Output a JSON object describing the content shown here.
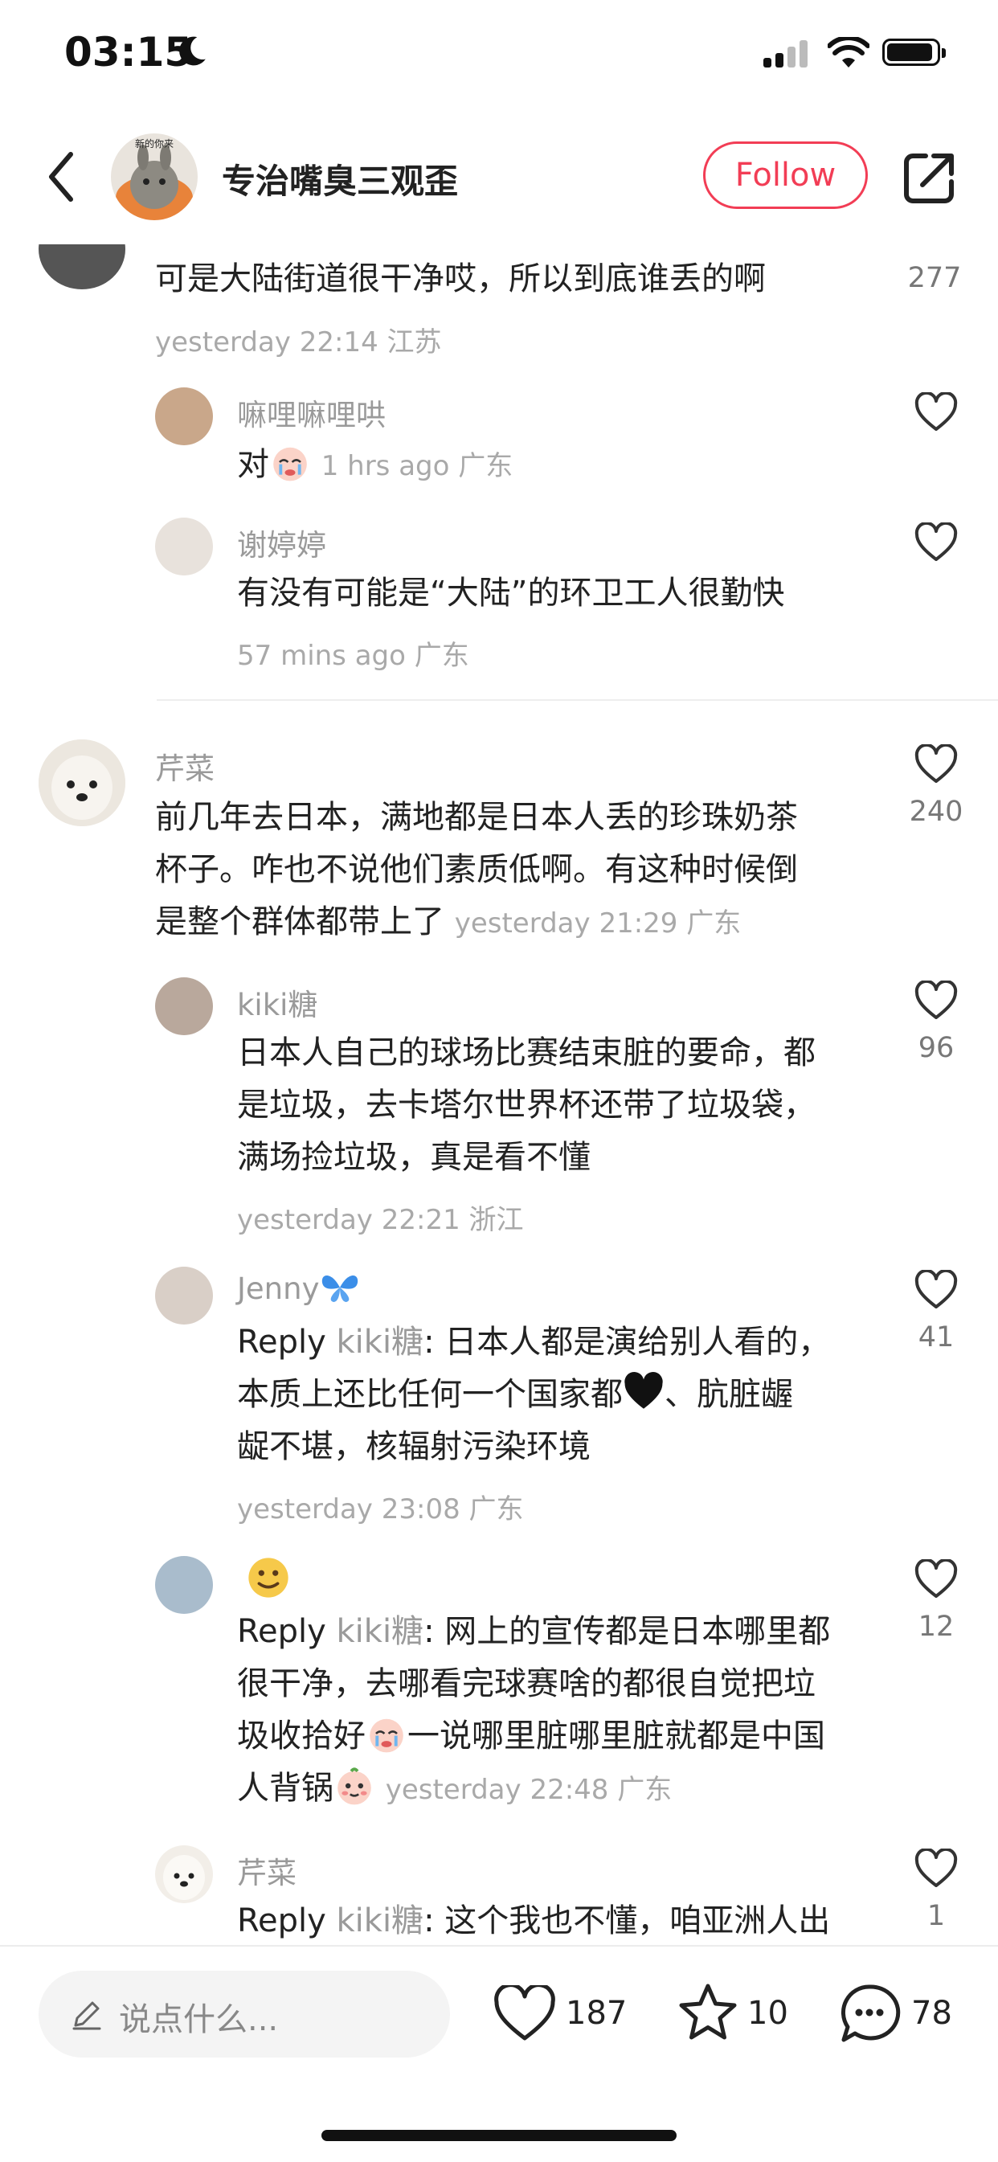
{
  "status_bar": {
    "time": "03:15"
  },
  "header": {
    "title": "专治嘴臭三观歪",
    "follow_label": "Follow",
    "avatar_caption": "新的你来"
  },
  "comments": {
    "c0": {
      "text": "可是大陆街道很干净哎，所以到底谁丢的啊",
      "meta": "yesterday 22:14 江苏",
      "likes": "277"
    },
    "r0a": {
      "user": "嘛哩嘛哩哄",
      "text": "对",
      "meta": "1 hrs ago 广东"
    },
    "r0b": {
      "user": "谢婷婷",
      "text": "有没有可能是“大陆”的环卫工人很勤快",
      "meta": "57 mins ago 广东"
    },
    "c1": {
      "user": "芹菜",
      "text1": "前几年去日本，满地都是日本人丢的珍珠奶茶",
      "text2": "杯子。咋也不说他们素质低啊。有这种时候倒",
      "text3": "是整个群体都带上了",
      "meta": "yesterday 21:29 广东",
      "likes": "240"
    },
    "r1a": {
      "user": "kiki糖",
      "text1": "日本人自己的球场比赛结束脏的要命，都",
      "text2": "是垃圾，去卡塔尔世界杯还带了垃圾袋，",
      "text3": "满场捡垃圾，真是看不懂",
      "meta": "yesterday 22:21 浙江",
      "likes": "96"
    },
    "r1b": {
      "user": "Jenny",
      "reply_label": "Reply",
      "reply_target": "kiki糖",
      "text1": ": 日本人都是演给别人看的，",
      "text2": "本质上还比任何一个国家都",
      "text2b": "、肮脏龌",
      "text3": "龊不堪，核辐射污染环境",
      "meta": "yesterday 23:08 广东",
      "likes": "41"
    },
    "r1c": {
      "reply_label": "Reply",
      "reply_target": "kiki糖",
      "text1": ": 网上的宣传都是日本哪里都",
      "text2": "很干净，去哪看完球赛啥的都很自觉把垃",
      "text3a": "圾收拾好",
      "text3b": "一说哪里脏哪里脏就都是中国",
      "text4": "人背锅",
      "meta": "yesterday 22:48 广东",
      "likes": "12"
    },
    "r1d": {
      "user": "芹菜",
      "reply_label": "Reply",
      "reply_target": "kiki糖",
      "text1": ": 这个我也不懂，咱亚洲人出",
      "likes": "1"
    }
  },
  "bottom_bar": {
    "input_placeholder": "说点什么...",
    "likes": "187",
    "stars": "10",
    "comments": "78"
  },
  "colors": {
    "accent": "#f23d55",
    "muted": "#9a9a9a",
    "text": "#222222"
  }
}
